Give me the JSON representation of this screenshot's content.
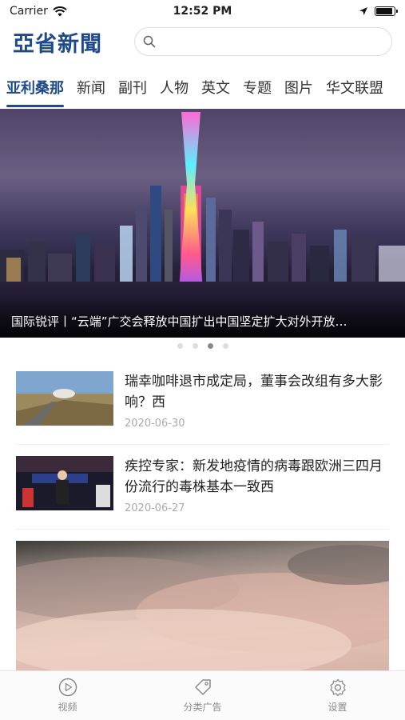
{
  "status": {
    "carrier": "Carrier",
    "time": "12:52 PM",
    "battery_level": 0.9
  },
  "header": {
    "logo": "亞省新聞",
    "search_placeholder": ""
  },
  "tabs": [
    {
      "label": "亚利桑那",
      "active": true
    },
    {
      "label": "新闻"
    },
    {
      "label": "副刊"
    },
    {
      "label": "人物"
    },
    {
      "label": "英文"
    },
    {
      "label": "专题"
    },
    {
      "label": "图片"
    },
    {
      "label": "华文联盟"
    }
  ],
  "banner": {
    "caption": "国际锐评丨“云端”广交会释放中国扩出中国坚定扩大对外开放…",
    "dot_count": 4,
    "active_dot": 2
  },
  "news": [
    {
      "title": "瑞幸咖啡退市成定局，董事会改组有多大影响？西",
      "date": "2020-06-30"
    },
    {
      "title": "疾控专家：新发地疫情的病毒跟欧洲三四月份流行的毒株基本一致西",
      "date": "2020-06-27"
    }
  ],
  "tabbar": [
    {
      "label": "视频",
      "icon": "play-icon"
    },
    {
      "label": "分类广告",
      "icon": "tag-icon"
    },
    {
      "label": "设置",
      "icon": "gear-icon"
    }
  ],
  "colors": {
    "brand": "#1e4a8a"
  }
}
